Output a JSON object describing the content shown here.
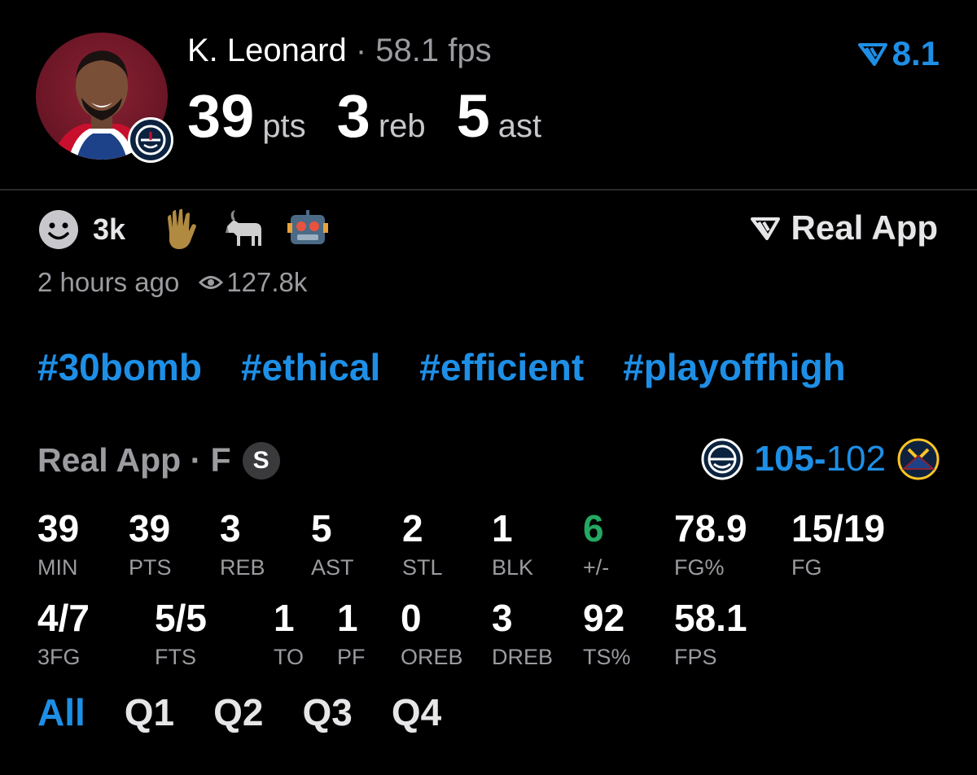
{
  "player": {
    "name": "K. Leonard",
    "separator": "·",
    "fps_label": "58.1 fps",
    "rating": "8.1",
    "big_stats": [
      {
        "value": "39",
        "unit": "pts"
      },
      {
        "value": "3",
        "unit": "reb"
      },
      {
        "value": "5",
        "unit": "ast"
      }
    ],
    "avatar_icon": "player-photo",
    "team_icon": "clippers-logo"
  },
  "social": {
    "reaction_count": "3k",
    "reactions": [
      "smiley-icon",
      "raised-hand-icon",
      "goat-icon",
      "robot-icon"
    ],
    "realapp_label": "Real App",
    "time_ago": "2 hours ago",
    "views": "127.8k"
  },
  "tags": [
    "#30bomb",
    "#ethical",
    "#efficient",
    "#playoffhigh"
  ],
  "game": {
    "source": "Real App · F",
    "badge": "S",
    "home_score": "105",
    "dash": "-",
    "away_score": "102",
    "home_icon": "clippers-logo",
    "away_icon": "nuggets-logo"
  },
  "stats_row1": [
    {
      "value": "39",
      "label": "MIN"
    },
    {
      "value": "39",
      "label": "PTS"
    },
    {
      "value": "3",
      "label": "REB"
    },
    {
      "value": "5",
      "label": "AST"
    },
    {
      "value": "2",
      "label": "STL"
    },
    {
      "value": "1",
      "label": "BLK"
    },
    {
      "value": "6",
      "label": "+/-"
    },
    {
      "value": "78.9",
      "label": "FG%"
    },
    {
      "value": "15/19",
      "label": "FG"
    }
  ],
  "stats_row2": [
    {
      "value": "4/7",
      "label": "3FG"
    },
    {
      "value": "5/5",
      "label": "FTS"
    },
    {
      "value": "1",
      "label": "TO"
    },
    {
      "value": "1",
      "label": "PF"
    },
    {
      "value": "0",
      "label": "OREB"
    },
    {
      "value": "3",
      "label": "DREB"
    },
    {
      "value": "92",
      "label": "TS%"
    },
    {
      "value": "58.1",
      "label": "FPS"
    }
  ],
  "quarters": [
    "All",
    "Q1",
    "Q2",
    "Q3",
    "Q4"
  ],
  "colors": {
    "accent": "#1e8fe6",
    "positive": "#24a862",
    "muted": "#9b9ba0"
  }
}
